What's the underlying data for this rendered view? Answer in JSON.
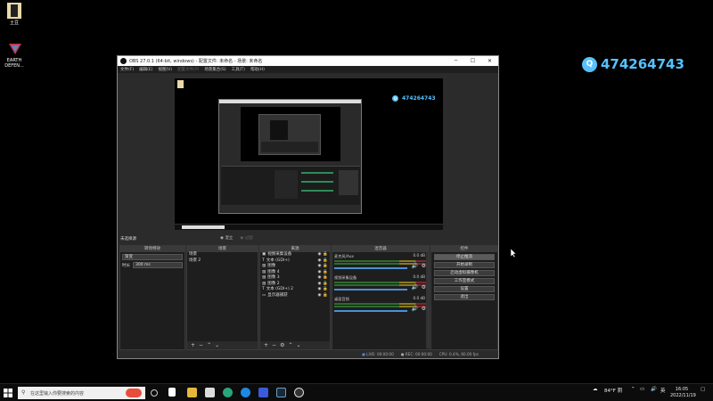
{
  "desktop": {
    "icons": [
      {
        "label": "土豆",
        "icon": "app-icon-tudou"
      },
      {
        "label": "EARTH DEFEN...",
        "icon": "app-icon-earth-defense"
      }
    ],
    "watermark": {
      "text": "474264743",
      "icon": "qq-icon",
      "color": "#56c1ff"
    }
  },
  "obs": {
    "title": "OBS 27.0.1 (64-bit, windows) - 配置文件: 未命名 - 场景: 未命名",
    "window_controls": [
      "─",
      "☐",
      "✕"
    ],
    "menu": [
      {
        "label": "文件(F)",
        "disabled": false
      },
      {
        "label": "编辑(E)",
        "disabled": false
      },
      {
        "label": "视图(V)",
        "disabled": false
      },
      {
        "label": "配置文件(P)",
        "disabled": true
      },
      {
        "label": "场景集合(S)",
        "disabled": false
      },
      {
        "label": "工具(T)",
        "disabled": false
      },
      {
        "label": "帮助(H)",
        "disabled": false
      }
    ],
    "preview_watermark": "474264743",
    "current_source": "未选择源",
    "radio_audio": "混立",
    "radio_video": "过滤",
    "docks": {
      "transitions": {
        "title": "转场特效",
        "type": "渐变",
        "duration_label": "时长",
        "duration_value": "300 ms"
      },
      "scenes": {
        "title": "场景",
        "items": [
          "场景",
          "场景 2"
        ]
      },
      "sources": {
        "title": "来源",
        "items": [
          {
            "icon": "video-capture-icon",
            "label": "视频采集设备"
          },
          {
            "icon": "text-icon",
            "label": "文本 (GDI+)"
          },
          {
            "icon": "image-icon",
            "label": "图像"
          },
          {
            "icon": "image-icon",
            "label": "图像 4"
          },
          {
            "icon": "image-icon",
            "label": "图像 3"
          },
          {
            "icon": "image-icon",
            "label": "图像 2"
          },
          {
            "icon": "text-icon",
            "label": "文本 (GDI+) 2"
          },
          {
            "icon": "display-capture-icon",
            "label": "显示器捕获"
          }
        ]
      },
      "mixer": {
        "title": "混音器",
        "channels": [
          {
            "name": "麦克风/Aux",
            "db": "0.0 dB"
          },
          {
            "name": "视频采集设备",
            "db": "0.0 dB"
          },
          {
            "name": "桌面音频",
            "db": "0.0 dB"
          }
        ]
      },
      "controls": {
        "title": "控件",
        "buttons": [
          "停止推流",
          "开始录制",
          "启动虚拟摄像机",
          "工作室模式",
          "设置",
          "退出"
        ]
      }
    },
    "status": {
      "live": "LIVE: 00:00:00",
      "rec": "REC: 00:00:00",
      "cpu": "CPU: 0.4%, 60.00 fps"
    }
  },
  "taskbar": {
    "search_placeholder": "在这里输入你要搜索的内容",
    "weather": "84°F 阴",
    "lang": "英",
    "time": "16:05",
    "date": "2022/11/19"
  }
}
